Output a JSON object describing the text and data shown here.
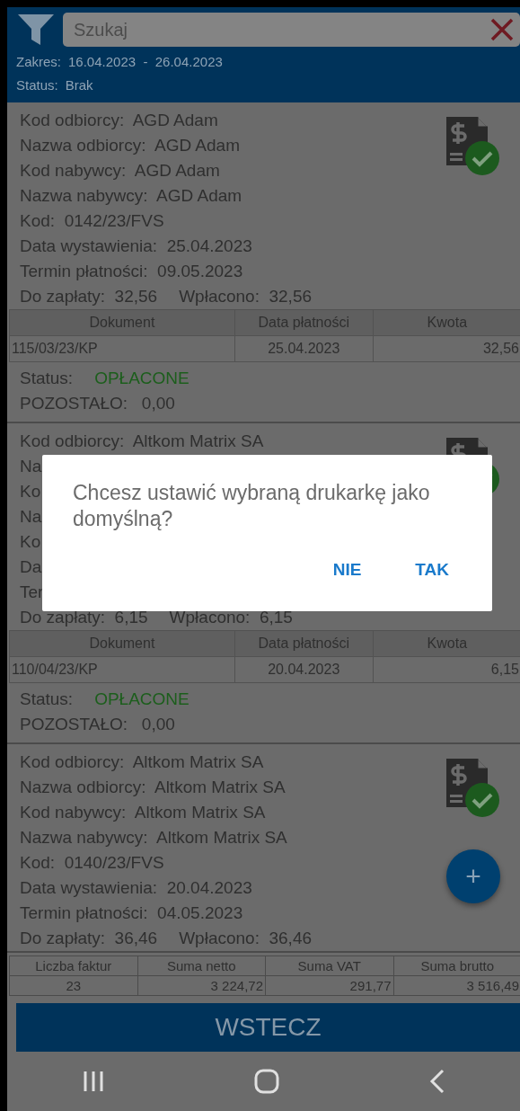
{
  "search": {
    "placeholder": "Szukaj"
  },
  "filter": {
    "range_label": "Zakres:",
    "range": "16.04.2023  -  26.04.2023",
    "status_label": "Status:",
    "status": "Brak"
  },
  "invoices": [
    {
      "fields": [
        "Kod odbiorcy:  AGD Adam",
        "Nazwa odbiorcy:  AGD Adam",
        "Kod nabywcy:  AGD Adam",
        "Nazwa nabywcy:  AGD Adam",
        "Kod:  0142/23/FVS",
        "Data wystawienia:  25.04.2023",
        "Termin płatności:  09.05.2023"
      ],
      "due": "Do zapłaty:  32,56",
      "paid": "Wpłacono:  32,56",
      "payments": {
        "columns": [
          "Dokument",
          "Data płatności",
          "Kwota"
        ],
        "rows": [
          [
            "115/03/23/KP",
            "25.04.2023",
            "32,56"
          ]
        ]
      },
      "status_label": "Status:",
      "status": "OPŁACONE",
      "remaining": "POZOSTAŁO:   0,00"
    },
    {
      "fields": [
        "Kod odbiorcy:  Altkom Matrix SA",
        "Na",
        "Ko",
        "Na",
        "Ko",
        "Da",
        "Ter"
      ],
      "due": "Do zapłaty:  6,15",
      "paid": "Wpłacono:  6,15",
      "payments": {
        "columns": [
          "Dokument",
          "Data płatności",
          "Kwota"
        ],
        "rows": [
          [
            "110/04/23/KP",
            "20.04.2023",
            "6,15"
          ]
        ]
      },
      "status_label": "Status:",
      "status": "OPŁACONE",
      "remaining": "POZOSTAŁO:   0,00"
    },
    {
      "fields": [
        "Kod odbiorcy:  Altkom Matrix SA",
        "Nazwa odbiorcy:  Altkom Matrix SA",
        "Kod nabywcy:  Altkom Matrix SA",
        "Nazwa nabywcy:  Altkom Matrix SA",
        "Kod:  0140/23/FVS",
        "Data wystawienia:  20.04.2023",
        "Termin płatności:  04.05.2023"
      ],
      "due": "Do zapłaty:  36,46",
      "paid": "Wpłacono:  36,46"
    }
  ],
  "fab": "+",
  "totals": {
    "columns": [
      "Liczba faktur",
      "Suma netto",
      "Suma VAT",
      "Suma brutto"
    ],
    "rows": [
      [
        "23",
        "3 224,72",
        "291,77",
        "3 516,49"
      ]
    ]
  },
  "back_button": "WSTECZ",
  "dialog": {
    "message": "Chcesz ustawić wybraną drukarkę jako domyślną?",
    "buttons": [
      "NIE",
      "TAK"
    ]
  }
}
